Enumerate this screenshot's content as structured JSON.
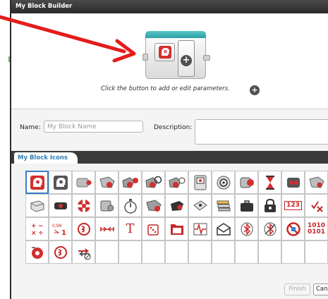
{
  "window": {
    "title": "My Block Builder"
  },
  "preview": {
    "hint": "Click the button to add or edit parameters.",
    "block_icon": "head-gear-icon",
    "add_parameter_icon": "plus-circle-icon",
    "cap_color": "#39b2b6"
  },
  "form": {
    "name_label": "Name:",
    "name_placeholder": "My Block Name",
    "name_value": "",
    "description_label": "Description:",
    "description_value": ""
  },
  "tabs": [
    {
      "label": "My Block Icons",
      "active": true
    }
  ],
  "icon_grid": {
    "selected_index": 0,
    "rows": [
      [
        "head-gear-icon",
        "head-gear-dark-icon",
        "medium-motor-icon",
        "large-motor-icon",
        "move-steering-icon",
        "move-tank-icon",
        "large-motor-rotation-icon",
        "brick-display-icon",
        "sound-icon",
        "color-sensor-icon",
        "timer-hourglass-icon",
        "infrared-sensor-icon",
        "ultrasonic-sensor-icon"
      ],
      [
        "brick-icon",
        "infrared-beacon-icon",
        "brick-buttons-icon",
        "gyro-sensor-icon",
        "stopwatch-icon",
        "motor-rotation-icon",
        "touch-sensor-icon",
        "ir-remote-icon",
        "data-stack-icon",
        "briefcase-icon",
        "lock-icon",
        "array-numbers-icon",
        "logic-operations-icon"
      ],
      [
        "math-operations-icon",
        "round-icon",
        "range-icon",
        "compare-icon",
        "text-icon",
        "random-icon",
        "file-access-icon",
        "waveform-icon",
        "messaging-icon",
        "bluetooth-icon",
        "bluetooth-off-icon",
        "stop-icon",
        "binary-icon"
      ],
      [
        "motor-red-icon",
        "range-small-icon",
        "loop-interrupt-icon",
        "",
        "",
        "",
        "",
        "",
        "",
        "",
        "",
        "",
        ""
      ]
    ],
    "labels": {
      "round": "0,99 → 1",
      "array": "123",
      "binary_top": "1010",
      "binary_bottom": "0101",
      "text": "T",
      "math": "+ − × ÷"
    }
  },
  "buttons": {
    "finish": "Finish",
    "cancel": "Cancel"
  },
  "colors": {
    "accent_red": "#c62828",
    "tab_blue": "#2f7eb8",
    "selection_blue": "#3a7dc9",
    "arrow_red": "#e41c1c"
  }
}
